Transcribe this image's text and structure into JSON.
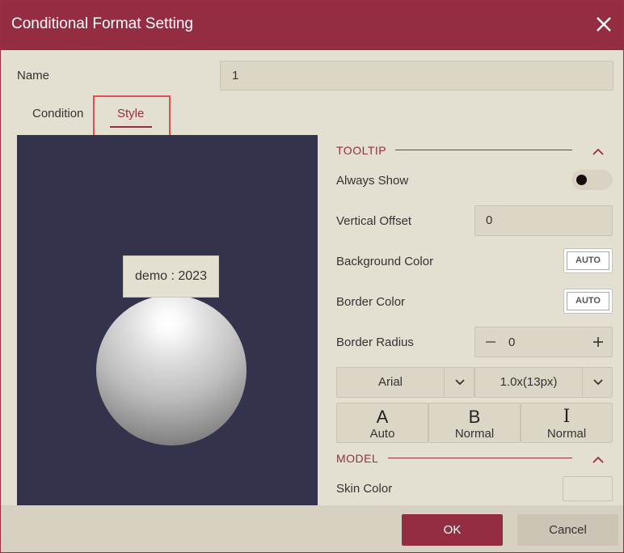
{
  "dialog": {
    "title": "Conditional Format Setting",
    "close_icon": "close-icon"
  },
  "name": {
    "label": "Name",
    "value": "1"
  },
  "tabs": [
    {
      "label": "Condition",
      "active": false
    },
    {
      "label": "Style",
      "active": true
    }
  ],
  "preview": {
    "tooltip_text": "demo : 2023"
  },
  "tooltip_section": {
    "title": "TOOLTIP",
    "collapse_icon": "chevron-up-icon",
    "always_show": {
      "label": "Always Show",
      "on": false
    },
    "vertical_offset": {
      "label": "Vertical Offset",
      "value": "0"
    },
    "background_color": {
      "label": "Background Color",
      "value": "AUTO"
    },
    "border_color": {
      "label": "Border Color",
      "value": "AUTO"
    },
    "border_radius": {
      "label": "Border Radius",
      "value": "0"
    },
    "font_family": "Arial",
    "font_size": "1.0x(13px)",
    "color_button": {
      "glyph": "A",
      "caption": "Auto"
    },
    "weight_button": {
      "glyph": "B",
      "caption": "Normal"
    },
    "style_button": {
      "glyph": "I",
      "caption": "Normal"
    }
  },
  "model_section": {
    "title": "MODEL",
    "collapse_icon": "chevron-up-icon",
    "skin_color": {
      "label": "Skin Color"
    }
  },
  "footer": {
    "ok_label": "OK",
    "cancel_label": "Cancel"
  },
  "colors": {
    "accent": "#952d42",
    "background": "#e3dfd1",
    "preview_bg": "#33334d",
    "highlight": "#e0504f"
  }
}
